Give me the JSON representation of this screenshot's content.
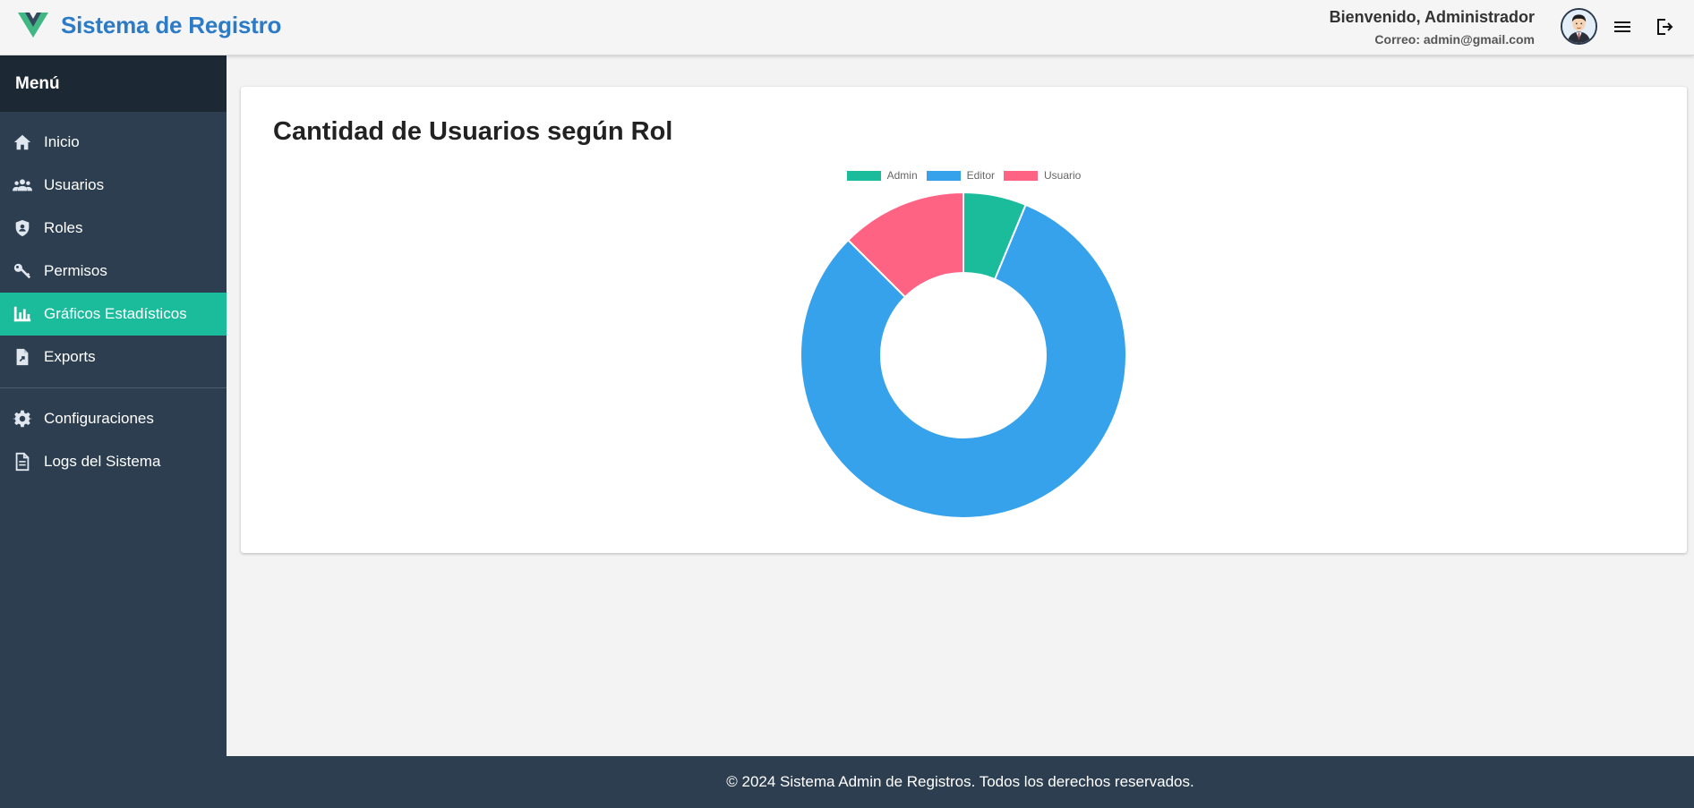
{
  "header": {
    "title": "Sistema de Registro",
    "welcome": "Bienvenido, Administrador",
    "email": "Correo: admin@gmail.com"
  },
  "sidebar": {
    "heading": "Menú",
    "items": [
      {
        "label": "Inicio",
        "icon": "home-icon"
      },
      {
        "label": "Usuarios",
        "icon": "users-icon"
      },
      {
        "label": "Roles",
        "icon": "shield-icon"
      },
      {
        "label": "Permisos",
        "icon": "key-icon"
      },
      {
        "label": "Gráficos Estadísticos",
        "icon": "bar-chart-icon",
        "active": true
      },
      {
        "label": "Exports",
        "icon": "file-export-icon"
      }
    ],
    "items2": [
      {
        "label": "Configuraciones",
        "icon": "gear-icon"
      },
      {
        "label": "Logs del Sistema",
        "icon": "document-icon"
      }
    ]
  },
  "main": {
    "title": "Cantidad de Usuarios según Rol"
  },
  "chart_data": {
    "type": "pie",
    "subtype": "doughnut",
    "categories": [
      "Admin",
      "Editor",
      "Usuario"
    ],
    "values": [
      1,
      13,
      2
    ],
    "colors": [
      "#1abc9c",
      "#36a2eb",
      "#ff6384"
    ],
    "legend": "top"
  },
  "footer": {
    "text": "© 2024 Sistema Admin de Registros. Todos los derechos reservados."
  },
  "colors": {
    "brand": "#2c7bc6",
    "sidebar": "#2c3e50",
    "sidebar_header": "#1c2833",
    "active": "#1abc9c"
  }
}
